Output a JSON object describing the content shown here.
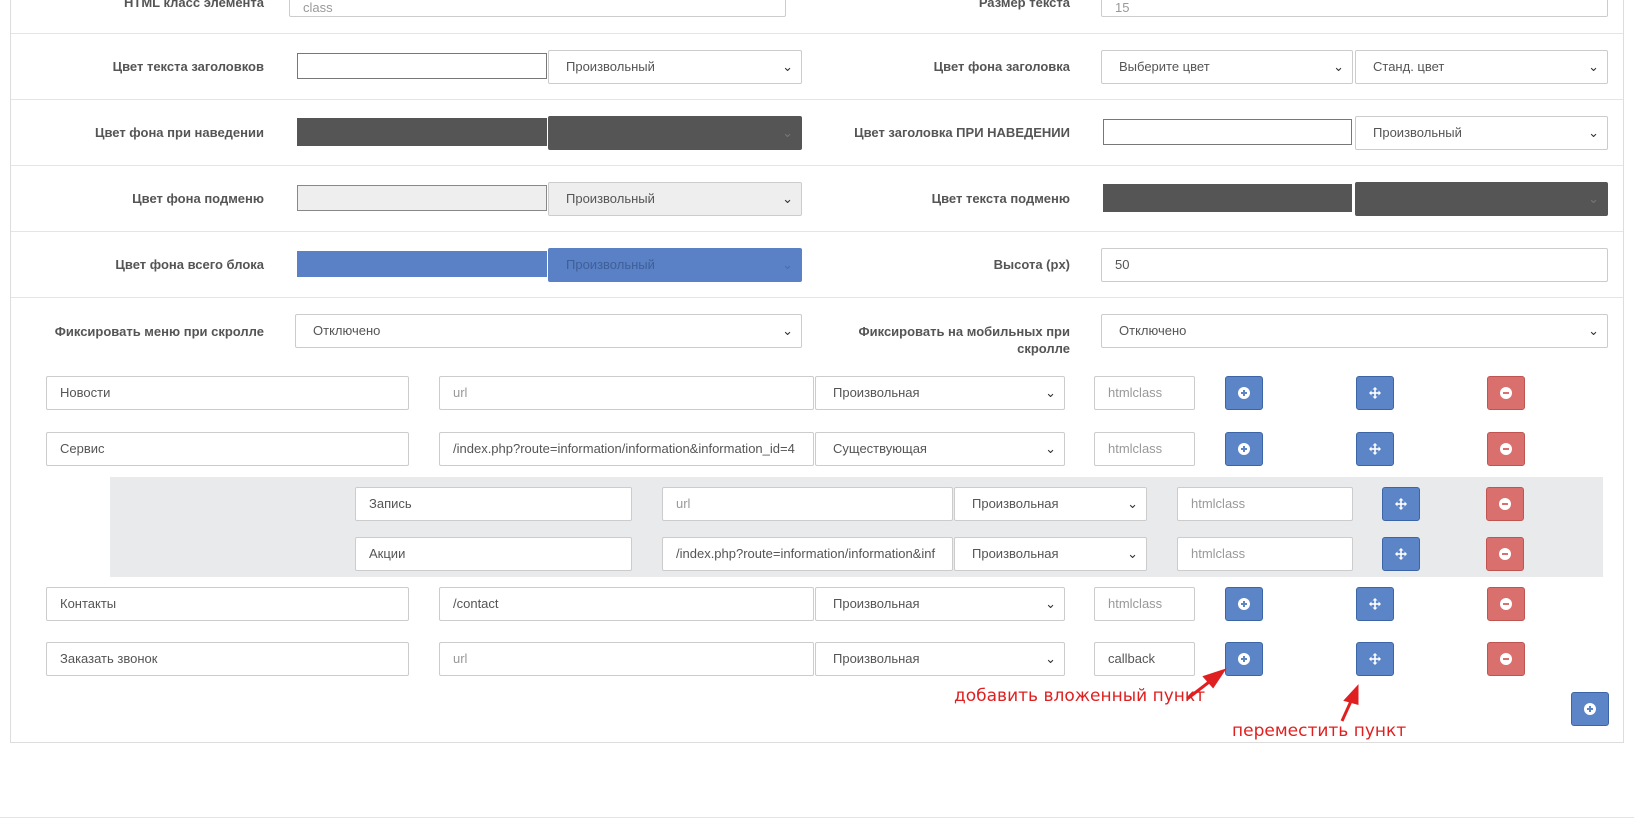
{
  "settings": {
    "html_class_label": "HTML класс элемента",
    "html_class_placeholder": "class",
    "text_size_label": "Размер текста",
    "text_size_value": "15",
    "heading_text_color_label": "Цвет текста заголовков",
    "heading_text_color_select": "Произвольный",
    "heading_bg_color_label": "Цвет фона заголовка",
    "heading_bg_color_select": "Выберите цвет",
    "heading_bg_color_select2": "Станд. цвет",
    "hover_bg_color_label": "Цвет фона при наведении",
    "hover_heading_color_label": "Цвет заголовка ПРИ НАВЕДЕНИИ",
    "hover_heading_color_select": "Произвольный",
    "submenu_bg_color_label": "Цвет фона подменю",
    "submenu_bg_color_select": "Произвольный",
    "submenu_text_color_label": "Цвет текста подменю",
    "block_bg_color_label": "Цвет фона всего блока",
    "block_bg_color_select": "Произвольный",
    "height_label": "Высота (px)",
    "height_value": "50",
    "fix_scroll_label": "Фиксировать меню при скролле",
    "fix_scroll_value": "Отключено",
    "fix_mobile_label": "Фиксировать на мобильных при скролле",
    "fix_mobile_value": "Отключено"
  },
  "colors": {
    "dark_swatch": "#555555",
    "light_swatch": "#eeeeee",
    "blue_swatch": "#5a81c5",
    "button_blue": "#5b85c7",
    "button_red": "#d9706d",
    "annotation": "#e02020"
  },
  "menu_items": [
    {
      "name": "Новости",
      "url": "",
      "url_placeholder": "url",
      "type": "Произвольная",
      "class": "",
      "class_placeholder": "htmlclass"
    },
    {
      "name": "Сервис",
      "url": "/index.php?route=information/information&information_id=4",
      "url_placeholder": "url",
      "type": "Существующая",
      "class": "",
      "class_placeholder": "htmlclass"
    },
    {
      "name": "Контакты",
      "url": "/contact",
      "url_placeholder": "url",
      "type": "Произвольная",
      "class": "",
      "class_placeholder": "htmlclass"
    },
    {
      "name": "Заказать звонок",
      "url": "",
      "url_placeholder": "url",
      "type": "Произвольная",
      "class": "callback",
      "class_placeholder": "htmlclass"
    }
  ],
  "sub_items": [
    {
      "name": "Запись",
      "url": "",
      "url_placeholder": "url",
      "type": "Произвольная",
      "class": "",
      "class_placeholder": "htmlclass"
    },
    {
      "name": "Акции",
      "url": "/index.php?route=information/information&inf",
      "url_placeholder": "url",
      "type": "Произвольная",
      "class": "",
      "class_placeholder": "htmlclass"
    }
  ],
  "icons": {
    "add": "plus-circle-icon",
    "move": "move-arrows-icon",
    "remove": "minus-circle-icon",
    "dropdown": "chevron-down-icon"
  },
  "annotations": {
    "add_nested": "добавить вложенный пункт",
    "move_item": "переместить пункт"
  }
}
